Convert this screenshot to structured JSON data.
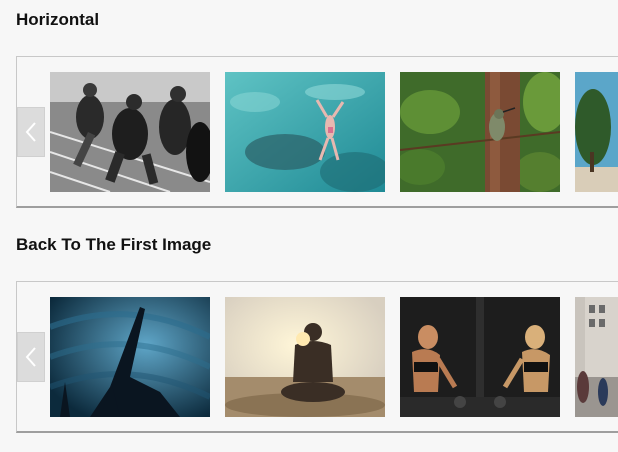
{
  "sections": [
    {
      "title": "Horizontal",
      "prev_icon": "chevron-left-icon",
      "slides": [
        {
          "subject": "sprinters"
        },
        {
          "subject": "swimmer"
        },
        {
          "subject": "hummingbird"
        },
        {
          "subject": "tree-sky"
        }
      ]
    },
    {
      "title": "Back To The First Image",
      "prev_icon": "chevron-left-icon",
      "slides": [
        {
          "subject": "silhouette-hand"
        },
        {
          "subject": "meditation-beach"
        },
        {
          "subject": "gym-boxing"
        },
        {
          "subject": "city-street"
        }
      ]
    }
  ],
  "colors": {
    "background": "#f7f7f7",
    "border": "#c8c8c8",
    "button": "#dcdcdc"
  }
}
